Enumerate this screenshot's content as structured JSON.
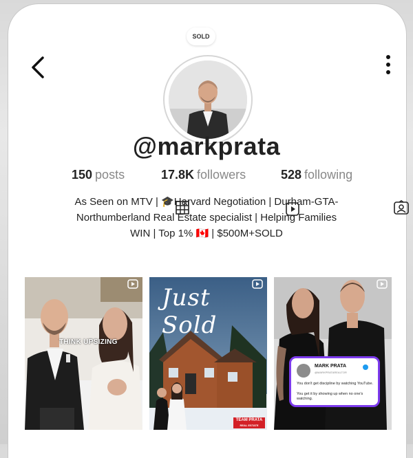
{
  "profile": {
    "badge": "SOLD",
    "username": "@markprata",
    "stats": [
      {
        "value": "150",
        "label": "posts"
      },
      {
        "value": "17.8K",
        "label": "followers"
      },
      {
        "value": "528",
        "label": "following"
      }
    ],
    "bio": [
      "As Seen on MTV | 🎓Harvard Negotiation | Durham-GTA-",
      "Northumberland Real Estate specialist | Helping Families",
      "WIN | Top 1% 🇨🇦 | $500M+SOLD"
    ]
  },
  "posts": [
    {
      "caption": "THINK UPSIZING",
      "icon": "play-icon"
    },
    {
      "caption": "Just Sold",
      "logo": "TEAM PRATA",
      "logo_sub": "REAL ESTATE",
      "icon": "play-icon"
    },
    {
      "card_name": "MARK PRATA",
      "card_handle": "@MARKPRATAREALTOR",
      "card_line1": "You don't get discipline by watching YouTube.",
      "card_line2": "You get it by showing up when no one's watching.",
      "icon": "play-icon"
    }
  ],
  "colors": {
    "brand_red": "#d32027",
    "card_border": "#7c3aed",
    "verified_blue": "#1d9bf0"
  }
}
